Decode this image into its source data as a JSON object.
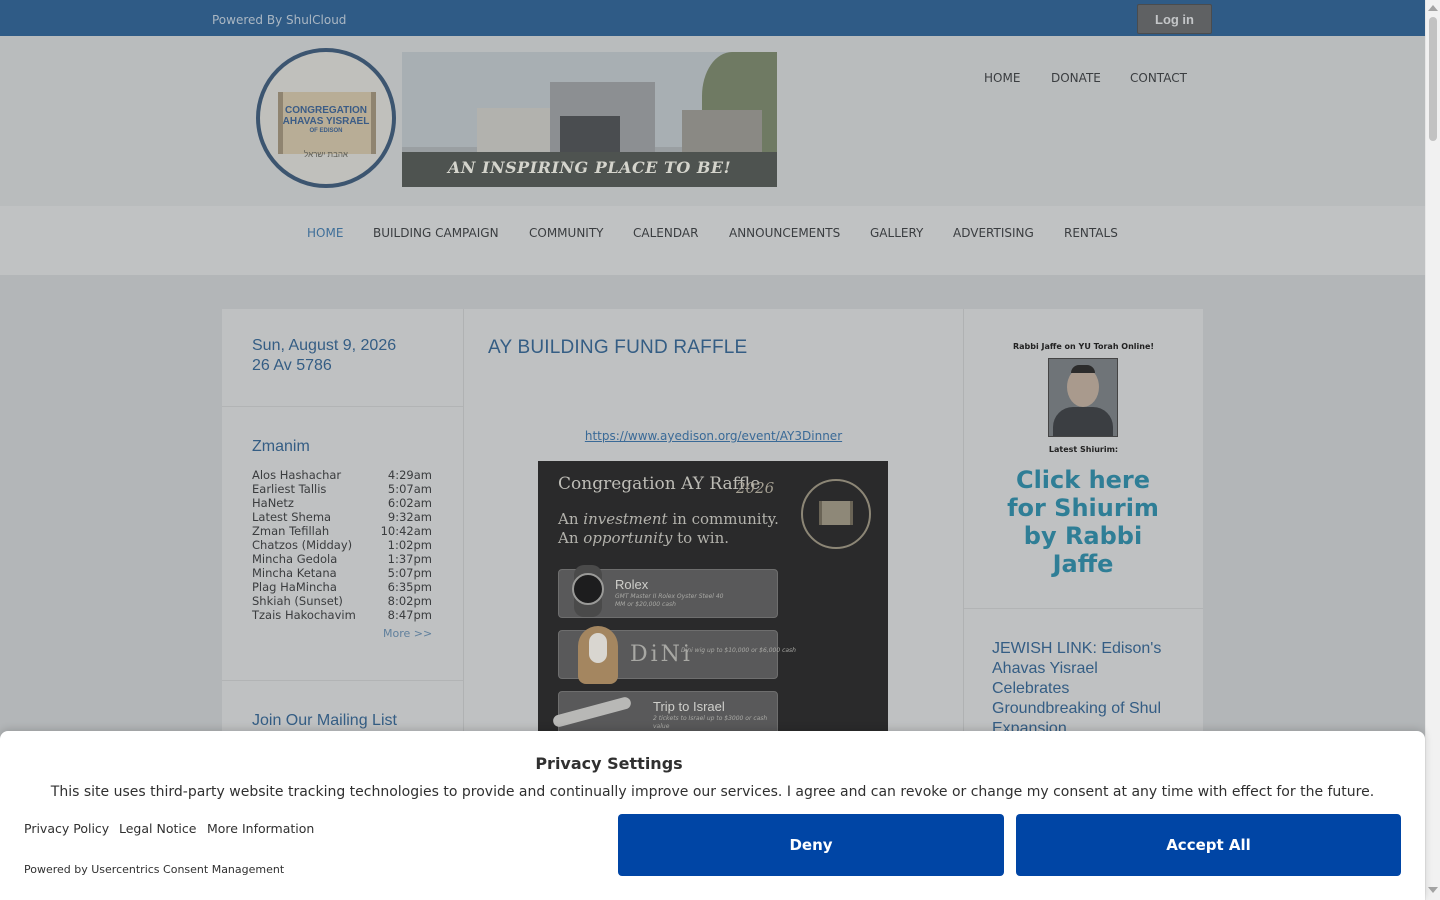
{
  "topbar": {
    "powered_by": "Powered By ShulCloud",
    "login_label": "Log in"
  },
  "logo": {
    "line1": "CONGREGATION",
    "line2": "AHAVAS YISRAEL",
    "line3": "OF EDISON",
    "hebrew": "אהבת ישראל"
  },
  "banner": {
    "tagline": "AN INSPIRING PLACE TO BE!"
  },
  "utility_nav": [
    "HOME",
    "DONATE",
    "CONTACT"
  ],
  "main_nav": [
    "HOME",
    "BUILDING CAMPAIGN",
    "COMMUNITY",
    "CALENDAR",
    "ANNOUNCEMENTS",
    "GALLERY",
    "ADVERTISING",
    "RENTALS"
  ],
  "main_nav_active": "HOME",
  "sidebar": {
    "date_gregorian": "Sun, August 9, 2026",
    "date_hebrew": "26 Av 5786",
    "zmanim_title": "Zmanim",
    "zmanim": [
      {
        "name": "Alos Hashachar",
        "time": "4:29am"
      },
      {
        "name": "Earliest Tallis",
        "time": "5:07am"
      },
      {
        "name": "HaNetz",
        "time": "6:02am"
      },
      {
        "name": "Latest Shema",
        "time": "9:32am"
      },
      {
        "name": "Zman Tefillah",
        "time": "10:42am"
      },
      {
        "name": "Chatzos (Midday)",
        "time": "1:02pm"
      },
      {
        "name": "Mincha Gedola",
        "time": "1:37pm"
      },
      {
        "name": "Mincha Ketana",
        "time": "5:07pm"
      },
      {
        "name": "Plag HaMincha",
        "time": "6:35pm"
      },
      {
        "name": "Shkiah (Sunset)",
        "time": "8:02pm"
      },
      {
        "name": "Tzais Hakochavim",
        "time": "8:47pm"
      }
    ],
    "more_link": "More >>",
    "mailing_list_title": "Join Our Mailing List"
  },
  "main": {
    "title": "AY BUILDING FUND RAFFLE",
    "link": "https://www.ayedison.org/event/AY3Dinner",
    "flyer": {
      "title": "Congregation AY Raffle",
      "year": "2026",
      "subtitle_1_prefix": "An ",
      "subtitle_1_em": "investment",
      "subtitle_1_suffix": " in community.",
      "subtitle_2_prefix": "An ",
      "subtitle_2_em": "opportunity",
      "subtitle_2_suffix": " to win.",
      "prizes": [
        {
          "name": "Rolex",
          "desc": "GMT Master II Rolex Oyster Steel 40 MM or $20,000 cash"
        },
        {
          "name": "DiNi",
          "desc": "Dini wig up to $10,000 or $6,000 cash"
        },
        {
          "name": "Trip to Israel",
          "desc": "2 tickets to Israel up to $3000 or cash value"
        }
      ]
    }
  },
  "right": {
    "yu_heading": "Rabbi Jaffe on YU Torah Online!",
    "latest_label": "Latest Shiurim:",
    "shiurim_link": "Click here for Shiurim by Rabbi Jaffe",
    "article_title": "JEWISH LINK: Edison's Ahavas Yisrael Celebrates Groundbreaking of Shul Expansion"
  },
  "consent": {
    "title": "Privacy Settings",
    "text": "This site uses third-party website tracking technologies to provide and continually improve our services. I agree and can revoke or change my consent at any time with effect for the future.",
    "links": [
      "Privacy Policy",
      "Legal Notice",
      "More Information"
    ],
    "powered_by": "Powered by Usercentrics Consent Management",
    "deny_label": "Deny",
    "accept_label": "Accept All"
  },
  "colors": {
    "topbar": "#2f5b86",
    "heading_blue": "#345d84",
    "link_teal": "#2f7e96",
    "consent_button": "#0045a5"
  }
}
